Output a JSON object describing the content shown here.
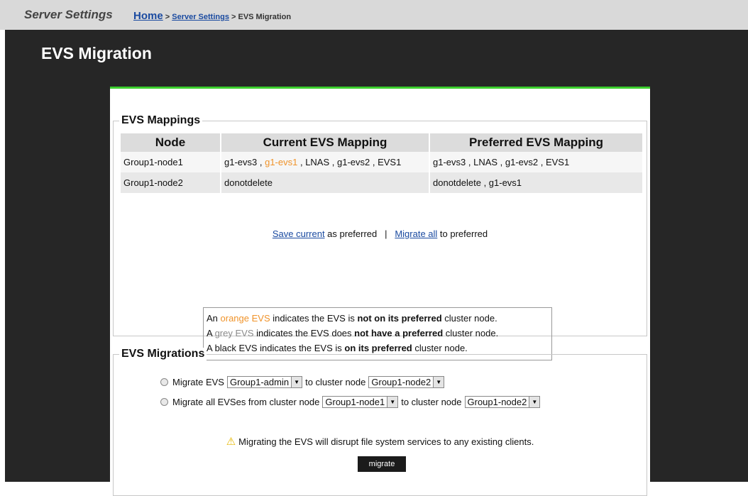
{
  "header": {
    "app_title": "Server Settings",
    "breadcrumb": {
      "home": "Home",
      "sep1": " > ",
      "server_settings": "Server Settings",
      "sep2": " > ",
      "current": "EVS Migration"
    }
  },
  "page_title": "EVS Migration",
  "mappings": {
    "legend": "EVS Mappings",
    "columns": [
      "Node",
      "Current EVS Mapping",
      "Preferred EVS Mapping"
    ],
    "rows": [
      {
        "node": "Group1-node1",
        "current": [
          {
            "text": "g1-evs3",
            "status": "black"
          },
          {
            "text": "g1-evs1",
            "status": "orange"
          },
          {
            "text": "LNAS",
            "status": "black"
          },
          {
            "text": "g1-evs2",
            "status": "black"
          },
          {
            "text": "EVS1",
            "status": "black"
          }
        ],
        "preferred": "g1-evs3 , LNAS , g1-evs2 , EVS1"
      },
      {
        "node": "Group1-node2",
        "current": [
          {
            "text": "donotdelete",
            "status": "black"
          }
        ],
        "preferred": "donotdelete , g1-evs1"
      }
    ],
    "actions": {
      "save_link": "Save current",
      "save_suffix": " as preferred",
      "separator": "|",
      "migrate_link": "Migrate all",
      "migrate_suffix": " to preferred"
    },
    "key": {
      "line1": {
        "prefix": "An ",
        "colored": "orange EVS",
        "middle": " indicates the EVS is ",
        "bold": "not on its preferred",
        "suffix": " cluster node."
      },
      "line2": {
        "prefix": "A ",
        "colored": "grey EVS",
        "middle": " indicates the EVS does ",
        "bold": "not have a preferred",
        "suffix": " cluster node."
      },
      "line3": {
        "prefix": "A black EVS indicates the EVS is ",
        "bold": "on its preferred",
        "suffix": " cluster node."
      }
    }
  },
  "migrations": {
    "legend": "EVS Migrations",
    "option1": {
      "label": "Migrate EVS",
      "evs_select": "Group1-admin",
      "to_label": "to cluster node",
      "node_select": "Group1-node2"
    },
    "option2": {
      "label": "Migrate all EVSes from cluster node",
      "from_select": "Group1-node1",
      "to_label": "to cluster node",
      "to_select": "Group1-node2"
    },
    "warning": "Migrating the EVS will disrupt file system services to any existing clients.",
    "button": "migrate"
  },
  "colors": {
    "orange": "#f0932a",
    "grey": "#8a8a8a",
    "accent_green": "#3ccf2e"
  }
}
